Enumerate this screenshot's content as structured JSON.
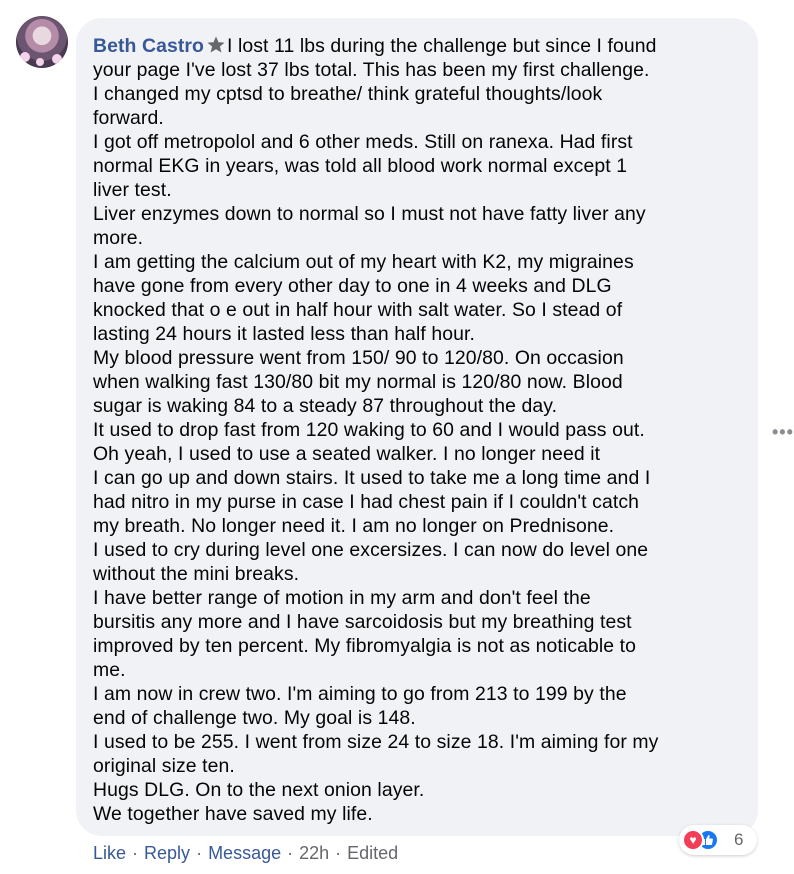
{
  "comment": {
    "author": "Beth Castro",
    "author_badge_icon": "star-badge-icon",
    "lines": [
      "I lost 11 lbs during the challenge but since I found",
      "your page I've lost 37 lbs total. This has been my first challenge.",
      "I changed my cptsd to breathe/ think grateful thoughts/look",
      "forward.",
      "I got off metropolol and 6 other meds. Still on ranexa. Had first",
      "normal EKG in years, was told all blood work normal except 1",
      "liver test.",
      "Liver enzymes down to normal so I must not have fatty liver any",
      "more.",
      "I am getting the calcium out of my heart with K2, my migraines",
      "have gone from every other day to one in 4 weeks and DLG",
      "knocked that o e out in half hour with salt water. So I stead of",
      "lasting 24 hours it lasted less than half hour.",
      "My blood pressure went from 150/ 90 to 120/80. On occasion",
      "when walking fast 130/80 bit my normal is 120/80 now. Blood",
      "sugar is waking 84 to a steady 87 throughout the day.",
      "It used to drop fast from 120 waking to 60 and I would pass out.",
      "Oh yeah, I used to use a seated walker. I no longer need it",
      "I can go up and down stairs. It used to take me a long time and I",
      "had nitro in my purse in case I had chest pain if I couldn't catch",
      "my breath. No longer need it. I am no longer on Prednisone.",
      "I used to cry during level one excersizes. I can now do level one",
      "without the mini breaks.",
      "I have better range of motion in my arm and don't feel the",
      "bursitis any more and I have sarcoidosis but my breathing test",
      "improved by ten percent. My fibromyalgia is not as noticable to",
      "me.",
      "I am now in crew two. I'm aiming to go from 213 to 199 by the",
      "end of challenge two. My goal is 148.",
      "I used to be 255. I went from size 24 to size 18. I'm aiming for my",
      "original size ten.",
      "Hugs DLG. On to the next onion layer.",
      "We together have saved my life."
    ]
  },
  "reactions": {
    "icons": [
      "love-reaction-icon",
      "like-reaction-icon"
    ],
    "count": "6"
  },
  "actions": {
    "like": "Like",
    "reply": "Reply",
    "message": "Message",
    "time": "22h",
    "edited": "Edited",
    "separator": "·"
  },
  "colors": {
    "link": "#385898",
    "bubble": "#f0f2f5",
    "meta": "#65676b",
    "love": "#f33e58",
    "like": "#1877f2"
  }
}
